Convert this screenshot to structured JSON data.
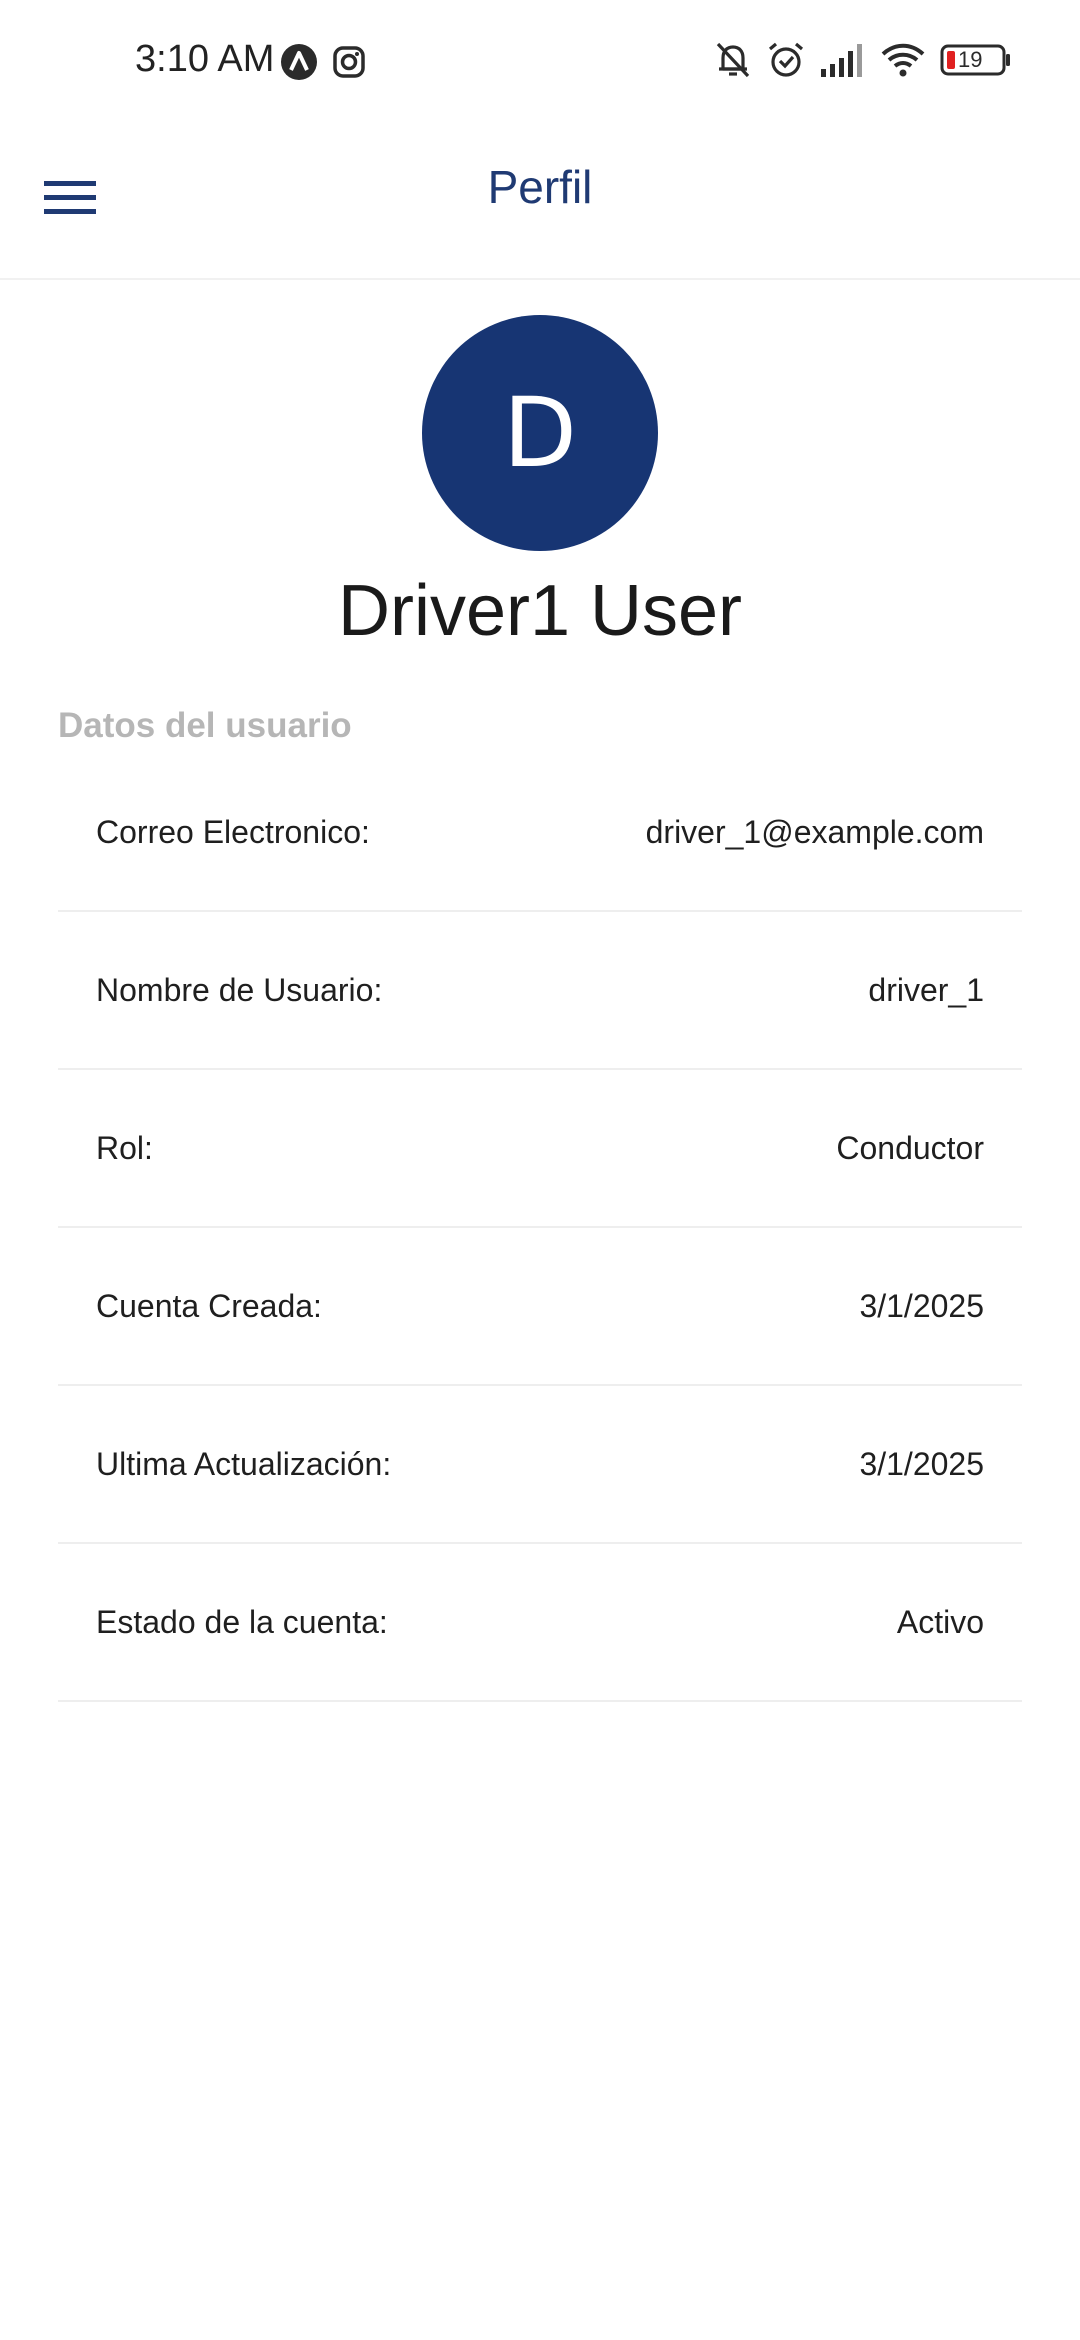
{
  "status_bar": {
    "time": "3:10 AM",
    "battery": "19",
    "icons": [
      "app-a-icon",
      "instagram-icon",
      "bell-off-icon",
      "alarm-icon",
      "signal-icon",
      "wifi-icon",
      "battery-icon"
    ]
  },
  "app_bar": {
    "title": "Perfil",
    "menu_icon": "menu-icon"
  },
  "profile": {
    "avatar_initial": "D",
    "name": "Driver1 User",
    "avatar_color": "#173573"
  },
  "section": {
    "title": "Datos del usuario"
  },
  "details": [
    {
      "label": "Correo Electronico:",
      "value": "driver_1@example.com"
    },
    {
      "label": "Nombre de Usuario:",
      "value": "driver_1"
    },
    {
      "label": "Rol:",
      "value": "Conductor"
    },
    {
      "label": "Cuenta Creada:",
      "value": "3/1/2025"
    },
    {
      "label": "Ultima Actualización:",
      "value": "3/1/2025"
    },
    {
      "label": "Estado de la cuenta:",
      "value": "Activo"
    }
  ],
  "colors": {
    "accent": "#1f3a73",
    "section_title": "#b6b6b6",
    "battery_low": "#e02020"
  }
}
